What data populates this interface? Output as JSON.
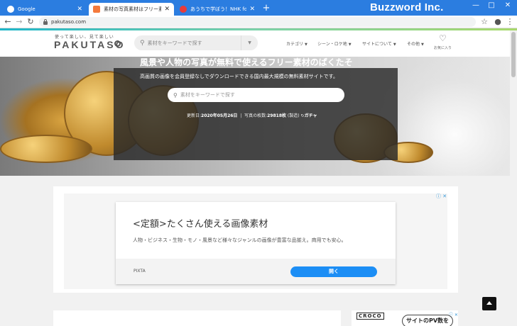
{
  "browser": {
    "tabs": [
      {
        "title": "Google",
        "favicon_color": "#ffffff",
        "active": false
      },
      {
        "title": "素材の写真素材はフリー素材のぱくたそ",
        "favicon_color": "#f47a3c",
        "active": true
      },
      {
        "title": "あうちで学ぼう！NHK for School",
        "favicon_color": "#e83b3b",
        "active": false
      }
    ],
    "new_tab": "+",
    "url": "pakutaso.com",
    "brand": "Buzzword Inc.",
    "window_controls": {
      "minimize": "—",
      "maximize": "□",
      "close": "✕"
    },
    "nav": {
      "back": "←",
      "forward": "→",
      "reload": "↻",
      "star": "☆",
      "menu": "⋮"
    },
    "accent_colors": {
      "tabbar": "#2b7de0",
      "cta": "#1c8ef5"
    }
  },
  "site": {
    "tagline": "使って楽しい、見て楽しい",
    "logo": "PAKUTASO",
    "search_placeholder": "素材をキーワードで探す",
    "nav": [
      {
        "label": "カテゴリ"
      },
      {
        "label": "シーン・ロケ地"
      },
      {
        "label": "サイトについて"
      },
      {
        "label": "その他"
      }
    ],
    "favorites_label": "お気に入り"
  },
  "hero": {
    "title": "風景や人物の写真が無料で使えるフリー素材のぱくたそ",
    "subtitle": "高画質の画像を会員登録なしでダウンロードできる国内最大規模の無料素材サイトです。",
    "search_placeholder": "素材をキーワードで探す",
    "updated_label": "更新日:",
    "updated_value": "2020年05月26日",
    "count_label": "写真の枚数:",
    "count_value": "29818枚",
    "random_label": "(製造)",
    "gacha_label": "ガチャ"
  },
  "ad": {
    "headline": "<定額>たくさん使える画像素材",
    "body": "人物・ビジネス・生物・モノ・風景など様々なジャンルの画像が豊富な品揃え。商用でも安心。",
    "source": "PIXTA",
    "cta": "開く",
    "choice": "ⓘ ✕"
  },
  "side_ad": {
    "brand": "CROCO",
    "bubble": "サイトのPV数を",
    "choice": "ⓘ ✕"
  }
}
